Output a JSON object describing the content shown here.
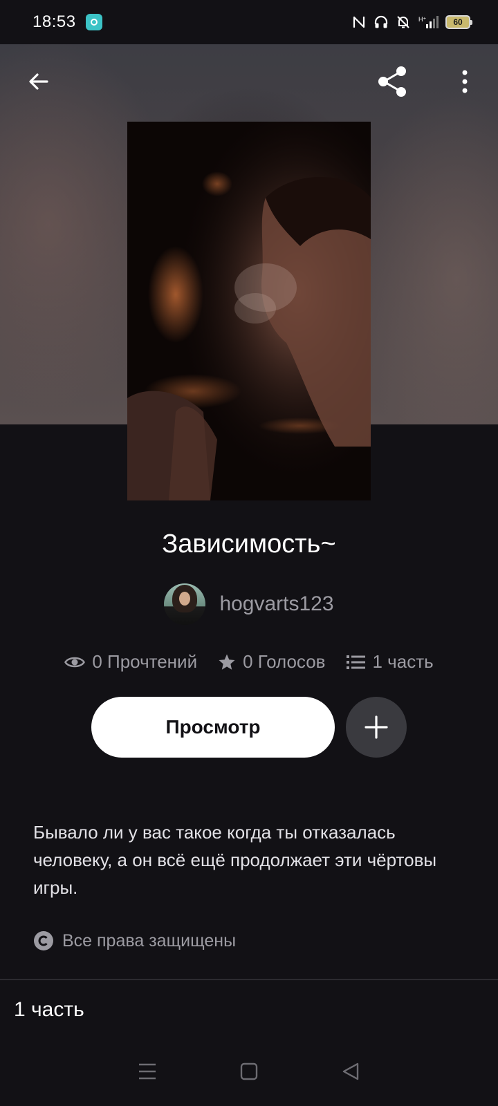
{
  "status_bar": {
    "time": "18:53",
    "battery": "60",
    "icons": [
      "app-notification-icon",
      "nfc-icon",
      "headphones-icon",
      "bell-off-icon",
      "signal-icon",
      "battery-icon"
    ]
  },
  "toolbar": {
    "back_icon": "arrow-left-icon",
    "share_icon": "share-icon",
    "more_icon": "more-vertical-icon"
  },
  "story": {
    "title": "Зависимость~",
    "author": "hogvarts123",
    "stats": {
      "reads": "0 Прочтений",
      "votes": "0 Голосов",
      "parts": "1 часть"
    },
    "view_button": "Просмотр",
    "description": "Бывало ли у вас такое когда ты отказалась человеку, а он всё ещё продолжает эти чёртовы игры.",
    "copyright": "Все права защищены",
    "parts_heading": "1 часть"
  },
  "nav": {
    "icons": [
      "menu-icon",
      "home-square-icon",
      "back-triangle-icon"
    ]
  },
  "colors": {
    "background": "#121115",
    "button": "#ffffff",
    "add_button": "#3a3a3f",
    "muted_text": "#9c9ba2"
  }
}
